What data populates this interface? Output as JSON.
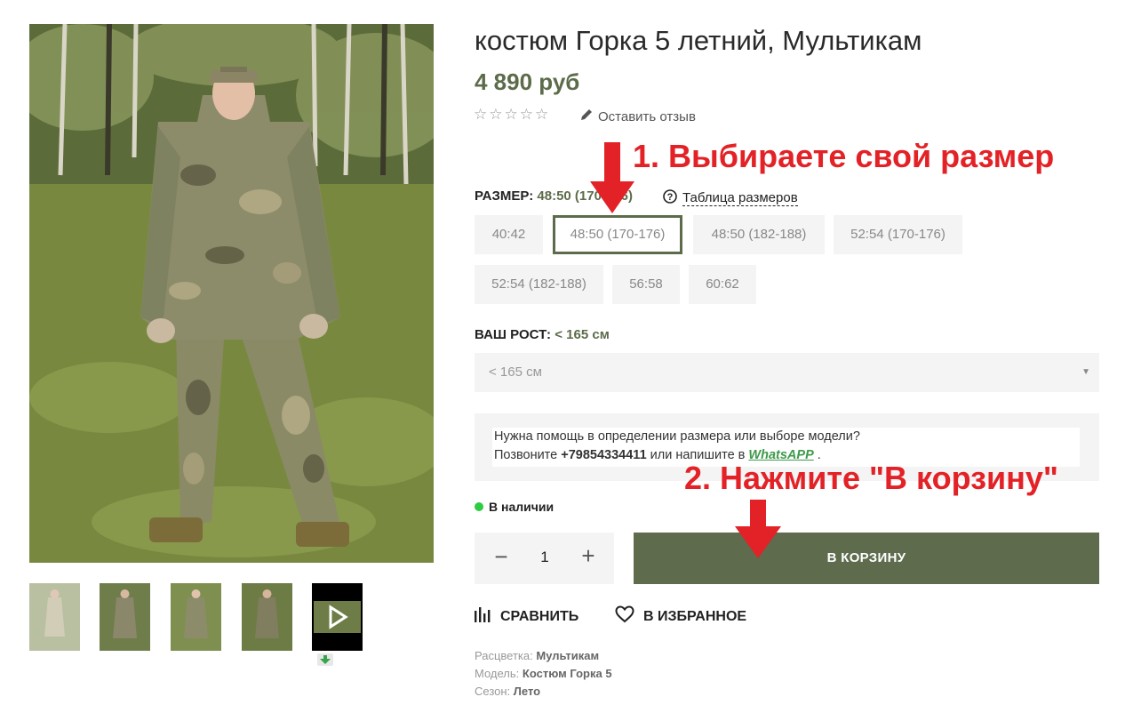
{
  "product": {
    "title": "костюм Горка 5 летний, Мультикам",
    "price": "4 890 руб",
    "review_link": "Оставить отзыв",
    "rating_stars": "☆☆☆☆☆"
  },
  "size": {
    "label": "РАЗМЕР:",
    "selected": "48:50 (170-176)",
    "chart_link": "Таблица размеров",
    "options": [
      "40:42",
      "48:50 (170-176)",
      "48:50 (182-188)",
      "52:54 (170-176)",
      "52:54 (182-188)",
      "56:58",
      "60:62"
    ]
  },
  "height": {
    "label": "ВАШ РОСТ:",
    "selected": "< 165 см",
    "select_value": "< 165 см"
  },
  "help": {
    "line1": "Нужна помощь в определении размера или выборе модели?",
    "line2_prefix": "Позвоните",
    "phone": "+79854334411",
    "line2_middle": "или напишите в",
    "whatsapp": "WhatsAPP",
    "line2_suffix": "."
  },
  "stock": {
    "status": "В наличии",
    "color": "#2ecc40"
  },
  "quantity": {
    "minus": "−",
    "value": "1",
    "plus": "+"
  },
  "cart_button": "В КОРЗИНУ",
  "actions": {
    "compare": "СРАВНИТЬ",
    "favorite": "В ИЗБРАННОЕ"
  },
  "properties": [
    {
      "label": "Расцветка:",
      "value": "Мультикам"
    },
    {
      "label": "Модель:",
      "value": "Костюм Горка 5"
    },
    {
      "label": "Сезон:",
      "value": "Лето"
    }
  ],
  "annotations": {
    "step1": "1. Выбираете свой размер",
    "step2": "2. Нажмите \"В корзину\""
  },
  "colors": {
    "accent": "#5c6c4a",
    "annotation": "#e32227",
    "button": "#5e6b4c"
  }
}
